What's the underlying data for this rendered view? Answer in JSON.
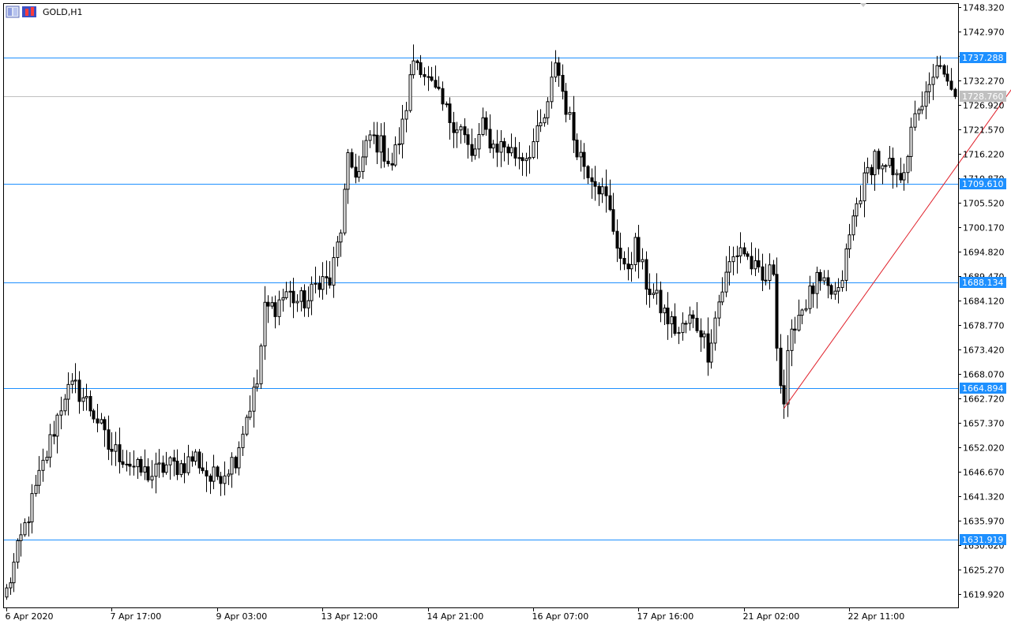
{
  "header": {
    "symbol_label": "GOLD,H1",
    "icons": [
      "window-icon",
      "chart-type-icon"
    ]
  },
  "chart_data": {
    "type": "candlestick",
    "symbol": "GOLD",
    "timeframe": "H1",
    "ylim": [
      1617.0,
      1749.0
    ],
    "y_ticks": [
      1748.32,
      1742.97,
      1737.62,
      1732.27,
      1726.92,
      1721.57,
      1716.22,
      1710.87,
      1705.52,
      1700.17,
      1694.82,
      1689.47,
      1684.12,
      1678.77,
      1673.42,
      1668.07,
      1662.72,
      1657.37,
      1652.02,
      1646.67,
      1641.32,
      1635.97,
      1630.62,
      1625.27,
      1619.92
    ],
    "x_tick_labels": [
      "6 Apr 2020",
      "7 Apr 17:00",
      "9 Apr 03:00",
      "13 Apr 12:00",
      "14 Apr 21:00",
      "16 Apr 07:00",
      "17 Apr 16:00",
      "21 Apr 02:00",
      "22 Apr 11:00"
    ],
    "x_tick_bar_index": [
      0,
      29,
      58,
      87,
      116,
      145,
      174,
      203,
      232
    ],
    "bar_count": 262,
    "horizontal_levels": [
      {
        "value": 1737.288,
        "label": "1737.288",
        "color": "#1e90ff"
      },
      {
        "value": 1709.61,
        "label": "1709.610",
        "color": "#1e90ff"
      },
      {
        "value": 1688.134,
        "label": "1688.134",
        "color": "#1e90ff"
      },
      {
        "value": 1664.894,
        "label": "1664.894",
        "color": "#1e90ff"
      },
      {
        "value": 1631.919,
        "label": "1631.919",
        "color": "#1e90ff"
      }
    ],
    "current_price": {
      "value": 1728.76,
      "label": "1728.760",
      "color": "#c0c0c0"
    },
    "trendline": {
      "from": {
        "bar": 214,
        "price": 1660.5
      },
      "to": {
        "bar": 290,
        "price": 1745.2
      },
      "color": "#e0202a"
    },
    "price_path": [
      [
        0,
        1620.5
      ],
      [
        4,
        1632
      ],
      [
        7,
        1640
      ],
      [
        10,
        1648
      ],
      [
        13,
        1656
      ],
      [
        16,
        1664
      ],
      [
        19,
        1665
      ],
      [
        22,
        1662
      ],
      [
        25,
        1658
      ],
      [
        28,
        1652
      ],
      [
        32,
        1650
      ],
      [
        36,
        1647
      ],
      [
        40,
        1646
      ],
      [
        44,
        1648
      ],
      [
        48,
        1648
      ],
      [
        52,
        1650
      ],
      [
        56,
        1645
      ],
      [
        60,
        1647
      ],
      [
        63,
        1650
      ],
      [
        66,
        1659
      ],
      [
        69,
        1666
      ],
      [
        71,
        1682
      ],
      [
        74,
        1683
      ],
      [
        77,
        1686
      ],
      [
        80,
        1684
      ],
      [
        83,
        1684
      ],
      [
        86,
        1689
      ],
      [
        89,
        1688
      ],
      [
        92,
        1700
      ],
      [
        94,
        1714
      ],
      [
        97,
        1712
      ],
      [
        100,
        1720
      ],
      [
        103,
        1718
      ],
      [
        106,
        1714
      ],
      [
        109,
        1722
      ],
      [
        112,
        1737
      ],
      [
        114,
        1736
      ],
      [
        116,
        1732
      ],
      [
        119,
        1728
      ],
      [
        122,
        1724
      ],
      [
        125,
        1722
      ],
      [
        128,
        1715
      ],
      [
        131,
        1722
      ],
      [
        134,
        1718
      ],
      [
        137,
        1718
      ],
      [
        140,
        1716
      ],
      [
        143,
        1716
      ],
      [
        146,
        1720
      ],
      [
        149,
        1726
      ],
      [
        151,
        1737
      ],
      [
        153,
        1730
      ],
      [
        156,
        1720
      ],
      [
        159,
        1714
      ],
      [
        162,
        1711
      ],
      [
        165,
        1706
      ],
      [
        168,
        1697
      ],
      [
        170,
        1690
      ],
      [
        173,
        1696
      ],
      [
        176,
        1688
      ],
      [
        179,
        1684
      ],
      [
        182,
        1680
      ],
      [
        185,
        1677
      ],
      [
        188,
        1680
      ],
      [
        191,
        1678
      ],
      [
        193,
        1673
      ],
      [
        196,
        1684
      ],
      [
        199,
        1692
      ],
      [
        202,
        1696
      ],
      [
        205,
        1692
      ],
      [
        208,
        1688
      ],
      [
        211,
        1691
      ],
      [
        212,
        1676
      ],
      [
        213,
        1666
      ],
      [
        214,
        1662
      ],
      [
        215,
        1671
      ],
      [
        217,
        1680
      ],
      [
        220,
        1684
      ],
      [
        223,
        1688
      ],
      [
        226,
        1686
      ],
      [
        229,
        1685
      ],
      [
        231,
        1694
      ],
      [
        233,
        1702
      ],
      [
        235,
        1708
      ],
      [
        237,
        1712
      ],
      [
        239,
        1716
      ],
      [
        241,
        1712
      ],
      [
        243,
        1713
      ],
      [
        245,
        1710
      ],
      [
        247,
        1714
      ],
      [
        249,
        1720
      ],
      [
        251,
        1727
      ],
      [
        253,
        1728
      ],
      [
        255,
        1732
      ],
      [
        257,
        1737
      ],
      [
        258,
        1732
      ],
      [
        260,
        1729
      ],
      [
        261,
        1728.76
      ]
    ]
  }
}
